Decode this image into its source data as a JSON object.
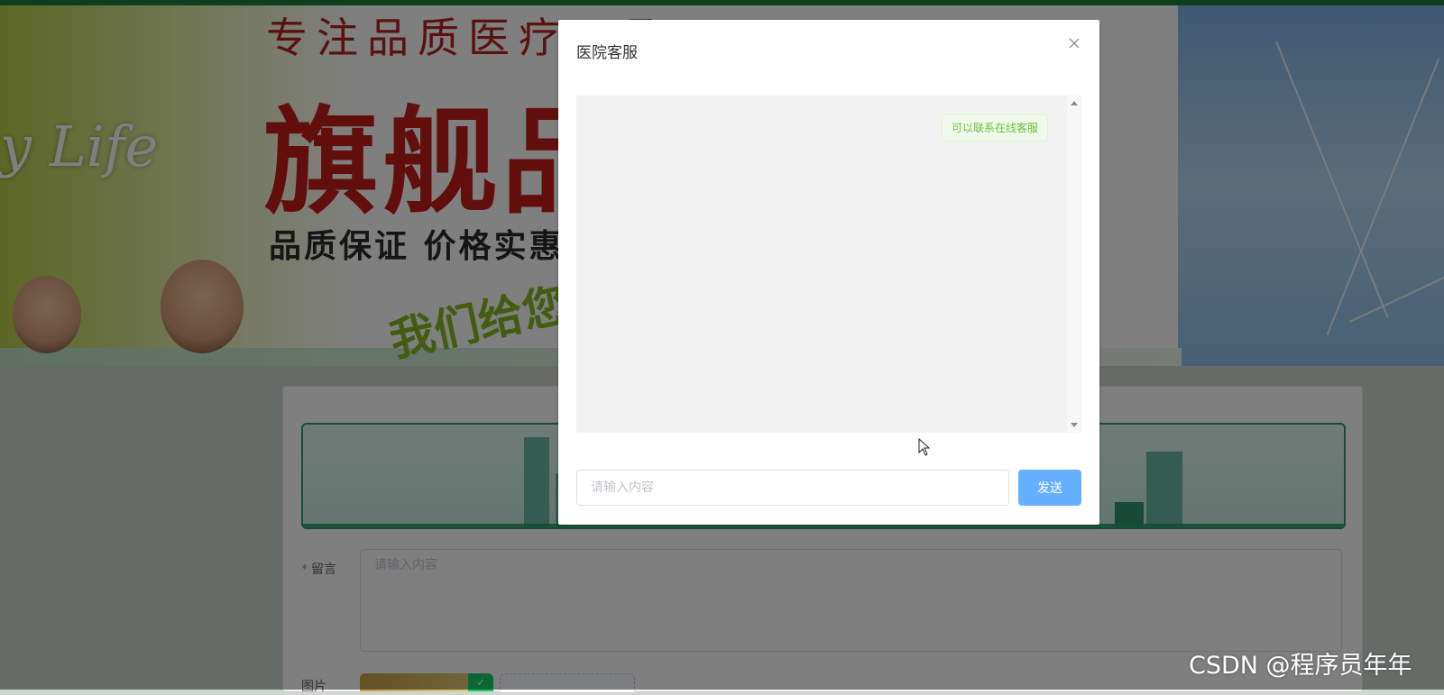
{
  "banner": {
    "slogan_top": "专注品质医疗用品",
    "slogan_big": "旗舰品",
    "slogan_mid": "品质保证 价格实惠",
    "slogan_green": "我们给您",
    "script_text": "y Life"
  },
  "form": {
    "message_label": "留言",
    "message_required_mark": "*",
    "message_placeholder": "请输入内容",
    "image_label": "图片"
  },
  "dialog": {
    "title": "医院客服",
    "close_icon": "close-icon",
    "messages": [
      {
        "from": "service",
        "text": "可以联系在线客服"
      }
    ],
    "input_placeholder": "请输入内容",
    "input_value": "",
    "send_label": "发送"
  },
  "colors": {
    "primary_button": "#66b1ff",
    "bubble_text": "#67c23a",
    "bubble_bg": "#f0f9eb",
    "banner_red": "#c51d1b",
    "topbar": "#1f7a3a"
  },
  "watermark": "CSDN @程序员年年"
}
